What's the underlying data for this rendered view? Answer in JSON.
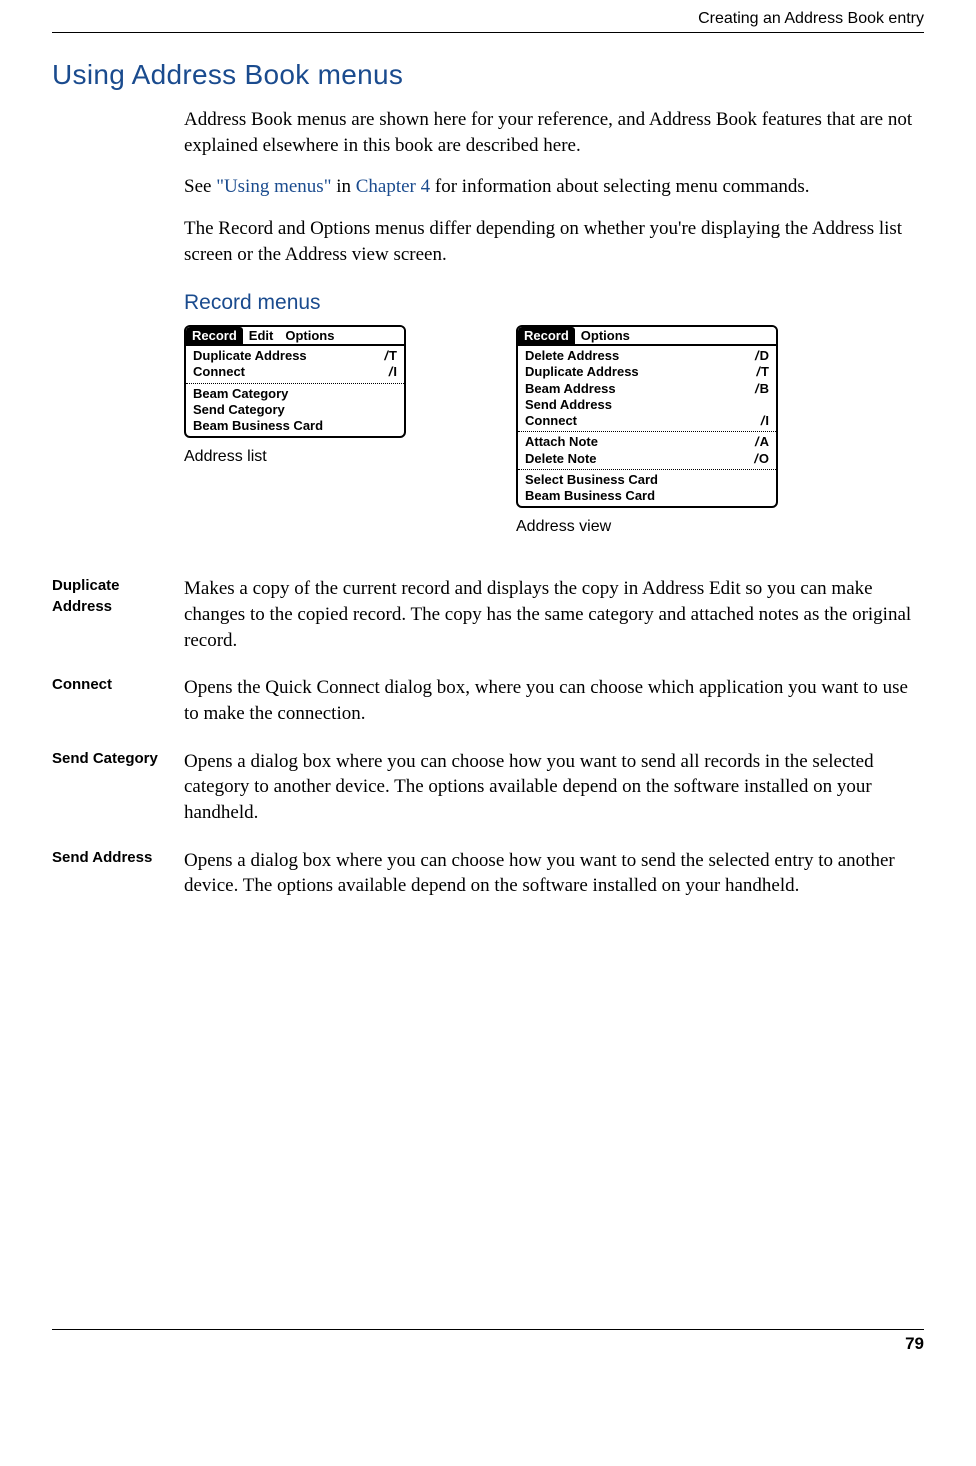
{
  "header": {
    "section": "Creating an Address Book entry"
  },
  "h1": "Using Address Book menus",
  "intro": {
    "p1": "Address Book menus are shown here for your reference, and Address Book features that are not explained elsewhere in this book are described here.",
    "p2a": "See ",
    "p2_link1": "\"Using menus\"",
    "p2b": " in ",
    "p2_link2": "Chapter 4",
    "p2c": " for information about selecting menu commands.",
    "p3": "The Record and Options menus differ depending on whether you're displaying the Address list screen or the Address view screen."
  },
  "h2": "Record menus",
  "menus": {
    "listCaption": "Address list",
    "viewCaption": "Address view",
    "listBar": [
      "Record",
      "Edit",
      "Options"
    ],
    "viewBar": [
      "Record",
      "Options"
    ],
    "listMenu": [
      [
        {
          "label": "Duplicate Address",
          "sc": "T"
        },
        {
          "label": "Connect",
          "sc": "I"
        }
      ],
      [
        {
          "label": "Beam Category",
          "sc": ""
        },
        {
          "label": "Send Category",
          "sc": ""
        },
        {
          "label": "Beam Business Card",
          "sc": ""
        }
      ]
    ],
    "viewMenu": [
      [
        {
          "label": "Delete Address",
          "sc": "D"
        },
        {
          "label": "Duplicate Address",
          "sc": "T"
        },
        {
          "label": "Beam Address",
          "sc": "B"
        },
        {
          "label": "Send Address",
          "sc": ""
        },
        {
          "label": "Connect",
          "sc": "I"
        }
      ],
      [
        {
          "label": "Attach Note",
          "sc": "A"
        },
        {
          "label": "Delete Note",
          "sc": "O"
        }
      ],
      [
        {
          "label": "Select Business Card",
          "sc": ""
        },
        {
          "label": "Beam Business Card",
          "sc": ""
        }
      ]
    ]
  },
  "defs": [
    {
      "term": "Duplicate Address",
      "desc": "Makes a copy of the current record and displays the copy in Address Edit so you can make changes to the copied record. The copy has the same category and attached notes as the original record."
    },
    {
      "term": "Connect",
      "desc": "Opens the Quick Connect dialog box, where you can choose which application you want to use to make the connection."
    },
    {
      "term": "Send Category",
      "desc": "Opens a dialog box where you can choose how you want to send all records in the selected category to another device. The options available depend on the software installed on your handheld."
    },
    {
      "term": "Send Address",
      "desc": "Opens a dialog box where you can choose how you want to send the selected entry to another device. The options available depend on the software installed on your handheld."
    }
  ],
  "pageNumber": "79"
}
